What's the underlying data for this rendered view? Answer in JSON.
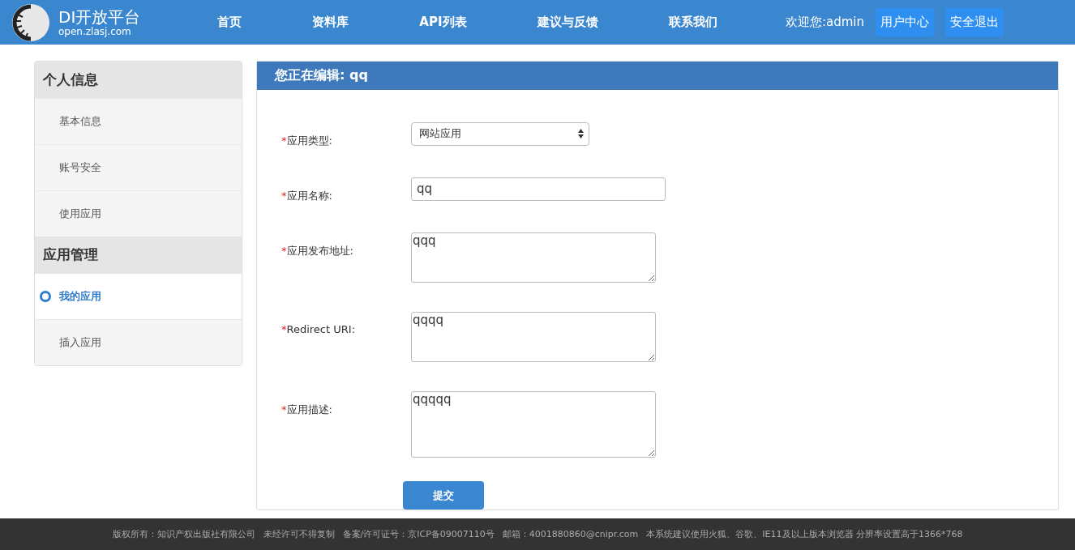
{
  "header": {
    "logo_title": "DI开放平台",
    "logo_subtitle": "open.zlasj.com",
    "nav": [
      {
        "label": "首页"
      },
      {
        "label": "资料库"
      },
      {
        "label": "API列表"
      },
      {
        "label": "建议与反馈"
      },
      {
        "label": "联系我们"
      }
    ],
    "welcome": "欢迎您:admin",
    "user_buttons": [
      {
        "label": "用户中心"
      },
      {
        "label": "安全退出"
      }
    ]
  },
  "sidebar": {
    "groups": [
      {
        "title": "个人信息",
        "items": [
          {
            "label": "基本信息",
            "selected": false
          },
          {
            "label": "账号安全",
            "selected": false
          },
          {
            "label": "使用应用",
            "selected": false
          }
        ]
      },
      {
        "title": "应用管理",
        "items": [
          {
            "label": "我的应用",
            "selected": true
          },
          {
            "label": "插入应用",
            "selected": false
          }
        ]
      }
    ]
  },
  "panel": {
    "title": "您正在编辑: qq",
    "fields": [
      {
        "kind": "select",
        "mark": "*",
        "label": "应用类型:",
        "value": "网站应用"
      },
      {
        "kind": "input",
        "mark": "*",
        "label": "应用名称:",
        "value": "qq"
      },
      {
        "kind": "textarea",
        "mark": "*",
        "label": "应用发布地址:",
        "value": "qqq"
      },
      {
        "kind": "textarea",
        "mark": "*",
        "label": "Redirect URI:",
        "value": "qqqq"
      },
      {
        "kind": "largetextarea",
        "mark": "*",
        "label": "应用描述:",
        "value": "qqqqq"
      }
    ],
    "submit": "提交"
  },
  "footer": [
    "版权所有：知识产权出版社有限公司",
    "未经许可不得复制",
    "备案/许可证号：京ICP备09007110号",
    "邮箱：4001880860@cnipr.com",
    "本系统建议使用火狐、谷歌、IE11及以上版本浏览器 分辨率设置高于1366*768"
  ]
}
